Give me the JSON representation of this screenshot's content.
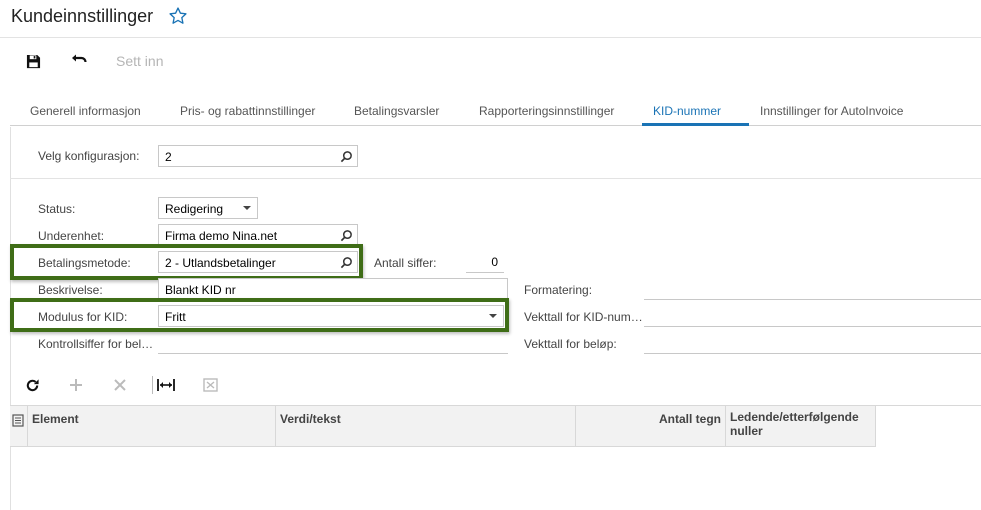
{
  "header": {
    "title": "Kundeinnstillinger"
  },
  "toolbar": {
    "insert_label": "Sett inn"
  },
  "tabs": [
    {
      "label": "Generell informasjon"
    },
    {
      "label": "Pris- og rabattinnstillinger"
    },
    {
      "label": "Betalingsvarsler"
    },
    {
      "label": "Rapporteringsinnstillinger"
    },
    {
      "label": "KID-nummer"
    },
    {
      "label": "Innstillinger for AutoInvoice"
    }
  ],
  "active_tab": "KID-nummer",
  "config": {
    "label": "Velg konfigurasjon:",
    "value": "2"
  },
  "form": {
    "status_label": "Status:",
    "status_value": "Redigering",
    "subunit_label": "Underenhet:",
    "subunit_value": "Firma demo Nina.net",
    "payment_label": "Betalingsmetode:",
    "payment_value": "2 - Utlandsbetalinger",
    "digits_label": "Antall siffer:",
    "digits_value": "0",
    "description_label": "Beskrivelse:",
    "description_value": "Blankt KID nr",
    "formatting_label": "Formatering:",
    "modulus_label": "Modulus for KID:",
    "modulus_value": "Fritt",
    "weight_kid_label": "Vekttall for KID-num…",
    "control_digit_label": "Kontrollsiffer for bel…",
    "weight_amount_label": "Vekttall for beløp:"
  },
  "grid": {
    "columns": [
      "Element",
      "Verdi/tekst",
      "Antall tegn",
      "Ledende/etterfølgende nuller"
    ]
  },
  "colors": {
    "accent": "#1a73b5",
    "highlight": "#3f6d17"
  }
}
